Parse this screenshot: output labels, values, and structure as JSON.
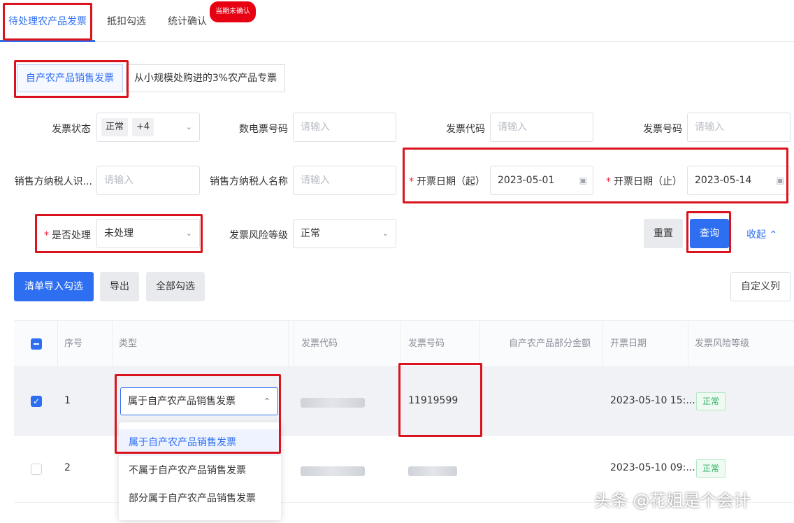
{
  "tabs": [
    {
      "label": "待处理农产品发票",
      "active": true
    },
    {
      "label": "抵扣勾选"
    },
    {
      "label": "统计确认"
    }
  ],
  "badge": "当期未确认",
  "subtabs": [
    {
      "label": "自产农产品销售发票",
      "active": true
    },
    {
      "label": "从小规模处购进的3%农产品专票"
    }
  ],
  "form": {
    "invoice_status": {
      "label": "发票状态",
      "tag": "正常",
      "more": "+4"
    },
    "digital_invoice_no": {
      "label": "数电票号码",
      "placeholder": "请输入"
    },
    "invoice_code": {
      "label": "发票代码",
      "placeholder": "请输入"
    },
    "invoice_number": {
      "label": "发票号码",
      "placeholder": "请输入"
    },
    "seller_tax_id": {
      "label": "销售方纳税人识...",
      "placeholder": "请输入"
    },
    "seller_name": {
      "label": "销售方纳税人名称",
      "placeholder": "请输入"
    },
    "date_start": {
      "label": "开票日期（起）",
      "value": "2023-05-01"
    },
    "date_end": {
      "label": "开票日期（止）",
      "value": "2023-05-14"
    },
    "processed": {
      "label": "是否处理",
      "value": "未处理"
    },
    "risk_level": {
      "label": "发票风险等级",
      "value": "正常"
    }
  },
  "buttons": {
    "reset": "重置",
    "query": "查询",
    "collapse": "收起",
    "import_check": "清单导入勾选",
    "export": "导出",
    "check_all": "全部勾选",
    "custom_columns": "自定义列"
  },
  "table": {
    "headers": [
      "序号",
      "类型",
      "发票代码",
      "发票号码",
      "自产农产品部分金额",
      "开票日期",
      "发票风险等级"
    ],
    "rows": [
      {
        "no": "1",
        "type": "属于自产农产品销售发票",
        "number": "11919599",
        "date": "2023-05-10 15:...",
        "risk": "正常",
        "checked": true
      },
      {
        "no": "2",
        "date": "2023-05-10 09:...",
        "risk": "正常",
        "checked": false
      }
    ]
  },
  "dropdown_options": [
    "属于自产农产品销售发票",
    "不属于自产农产品销售发票",
    "部分属于自产农产品销售发票"
  ],
  "watermark": "头条 @花姐是个会计"
}
